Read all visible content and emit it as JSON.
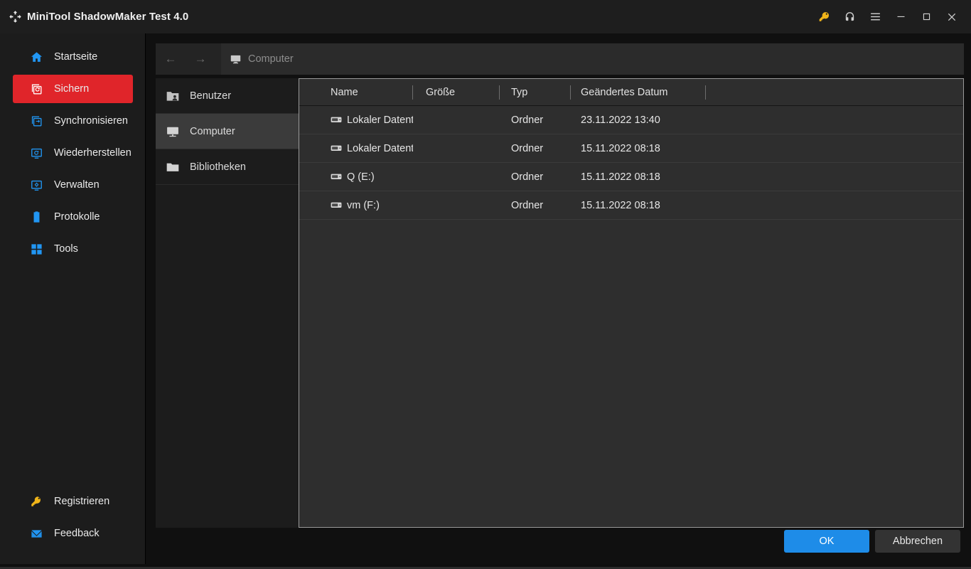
{
  "window": {
    "title": "MiniTool ShadowMaker Test 4.0",
    "logo_icon": "shadowmaker-logo-icon",
    "controls": [
      {
        "name": "key-icon",
        "label": ""
      },
      {
        "name": "headset-icon",
        "label": ""
      },
      {
        "name": "menu-icon",
        "label": ""
      },
      {
        "name": "minimize-icon",
        "label": ""
      },
      {
        "name": "maximize-icon",
        "label": ""
      },
      {
        "name": "close-icon",
        "label": ""
      }
    ]
  },
  "sidebar": {
    "items": [
      {
        "label": "Startseite",
        "icon": "home-icon",
        "active": false
      },
      {
        "label": "Sichern",
        "icon": "backup-icon",
        "active": true
      },
      {
        "label": "Synchronisieren",
        "icon": "sync-icon",
        "active": false
      },
      {
        "label": "Wiederherstellen",
        "icon": "restore-icon",
        "active": false
      },
      {
        "label": "Verwalten",
        "icon": "manage-icon",
        "active": false
      },
      {
        "label": "Protokolle",
        "icon": "logs-icon",
        "active": false
      },
      {
        "label": "Tools",
        "icon": "tools-icon",
        "active": false
      }
    ],
    "bottom_items": [
      {
        "label": "Registrieren",
        "icon": "key-icon"
      },
      {
        "label": "Feedback",
        "icon": "mail-icon"
      }
    ],
    "accent_color": "#e0252a",
    "icon_color": "#2196f3"
  },
  "addressbar": {
    "back_label": "←",
    "forward_label": "→",
    "breadcrumb_icon": "monitor-icon",
    "breadcrumb_text": "Computer"
  },
  "tree": {
    "items": [
      {
        "label": "Benutzer",
        "icon": "user-folder-icon",
        "selected": false
      },
      {
        "label": "Computer",
        "icon": "monitor-icon",
        "selected": true
      },
      {
        "label": "Bibliotheken",
        "icon": "folder-icon",
        "selected": false
      }
    ]
  },
  "filelist": {
    "columns": [
      "Name",
      "Größe",
      "Typ",
      "Geändertes Datum"
    ],
    "rows": [
      {
        "name": "Lokaler Datenträ…",
        "size": "",
        "type": "Ordner",
        "date": "23.11.2022 13:40",
        "icon": "drive-icon"
      },
      {
        "name": "Lokaler Datenträ…",
        "size": "",
        "type": "Ordner",
        "date": "15.11.2022 08:18",
        "icon": "drive-icon"
      },
      {
        "name": "Q (E:)",
        "size": "",
        "type": "Ordner",
        "date": "15.11.2022 08:18",
        "icon": "drive-icon"
      },
      {
        "name": "vm (F:)",
        "size": "",
        "type": "Ordner",
        "date": "15.11.2022 08:18",
        "icon": "drive-icon"
      }
    ]
  },
  "footer": {
    "ok_label": "OK",
    "cancel_label": "Abbrechen",
    "ok_color": "#1e8ce8"
  }
}
